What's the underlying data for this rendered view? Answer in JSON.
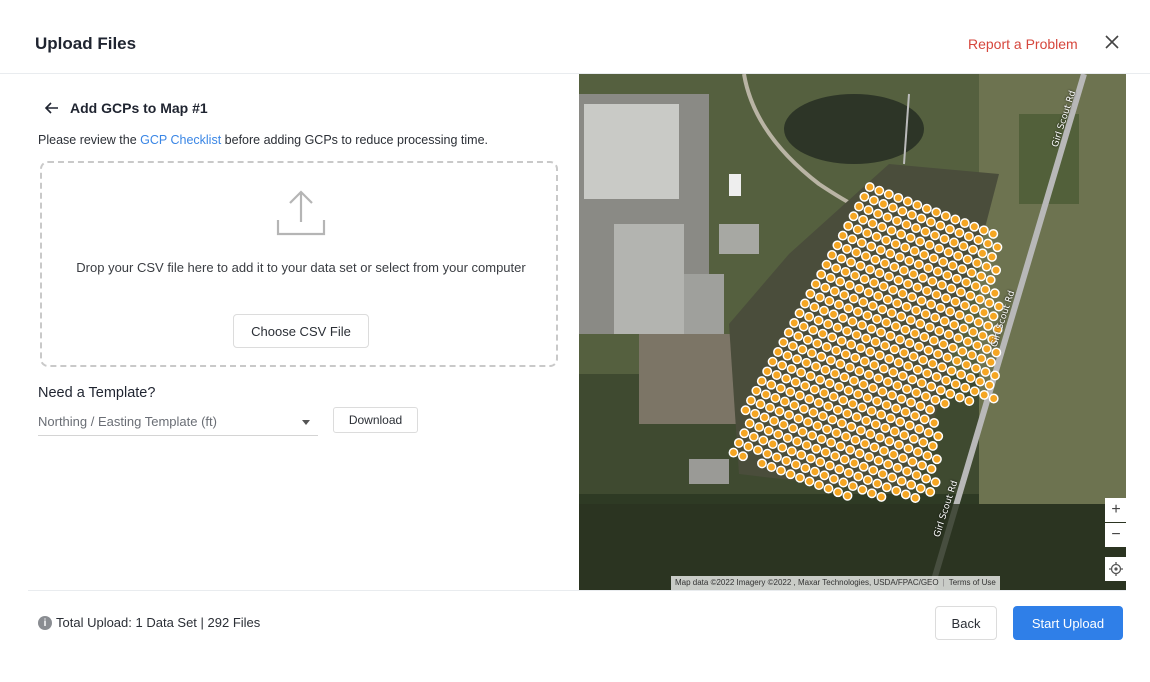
{
  "header": {
    "title": "Upload Files",
    "report_label": "Report a Problem",
    "close_icon": "close-icon",
    "accent_color": "#d6463c"
  },
  "panel": {
    "back_title": "Add GCPs to Map #1",
    "review_prefix": "Please review the ",
    "review_link": "GCP Checklist",
    "review_suffix": " before adding GCPs to reduce processing time.",
    "link_color": "#3a86e5",
    "dropzone": {
      "icon": "upload-icon",
      "text": "Drop your CSV file here to add it to your data set or select from your computer",
      "button_label": "Choose CSV File"
    },
    "template": {
      "heading": "Need a Template?",
      "selected": "Northing / Easting Template (ft)",
      "download_label": "Download"
    }
  },
  "map": {
    "road_labels": [
      "Girl Scout Rd",
      "Girl Scout Rd",
      "Girl Scout Rd"
    ],
    "attribution": "Map data ©2022 Imagery ©2022 , Maxar Technologies, USDA/FPAC/GEO",
    "terms": "Terms of Use",
    "zoom_in": "+",
    "zoom_out": "−",
    "marker_color": "#f5a623",
    "marker_border": "#ffffff"
  },
  "footer": {
    "info_icon": "i",
    "total_label": "Total Upload: 1 Data Set | 292 Files",
    "back_label": "Back",
    "start_label": "Start Upload",
    "primary_color": "#2f7fe8"
  }
}
